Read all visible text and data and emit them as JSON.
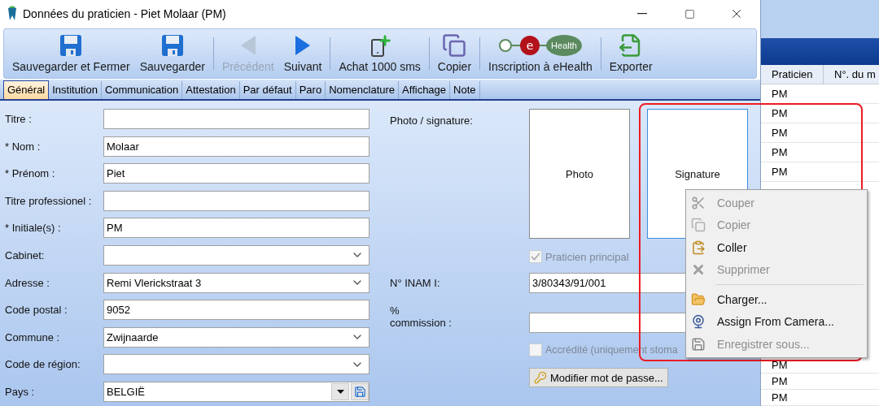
{
  "window": {
    "title": "Données du praticien - Piet Molaar (PM)"
  },
  "toolbar_groups": [
    [
      {
        "kind": "save-close",
        "label": "Sauvegarder et Fermer",
        "disabled": false
      },
      {
        "kind": "save",
        "label": "Sauvegarder",
        "disabled": false
      }
    ],
    [
      {
        "kind": "previous",
        "label": "Précédent",
        "disabled": true
      },
      {
        "kind": "next",
        "label": "Suivant",
        "disabled": false
      }
    ],
    [
      {
        "kind": "sms",
        "label": "Achat 1000 sms",
        "disabled": false
      }
    ],
    [
      {
        "kind": "copy",
        "label": "Copier",
        "disabled": false
      }
    ],
    [
      {
        "kind": "ehealth",
        "label": "Inscription à eHealth",
        "logo_texts": [
          "e",
          "Health"
        ],
        "disabled": false
      }
    ],
    [
      {
        "kind": "export",
        "label": "Exporter",
        "disabled": false
      }
    ]
  ],
  "tabs": [
    {
      "label": "Général",
      "selected": true
    },
    {
      "label": "Institution",
      "selected": false
    },
    {
      "label": "Communication",
      "selected": false
    },
    {
      "label": "Attestation",
      "selected": false
    },
    {
      "label": "Par défaut",
      "selected": false
    },
    {
      "label": "Paro",
      "selected": false
    },
    {
      "label": "Nomenclature",
      "selected": false
    },
    {
      "label": "Affichage",
      "selected": false
    },
    {
      "label": "Note",
      "selected": false
    }
  ],
  "fields": [
    {
      "label": "Titre :",
      "kind": "text"
    },
    {
      "label": "* Nom :",
      "kind": "text",
      "value": "Molaar"
    },
    {
      "label": "* Prénom :",
      "kind": "text",
      "value": "Piet"
    },
    {
      "label": "Titre professionel :",
      "kind": "text"
    },
    {
      "label": "* Initiale(s) :",
      "kind": "text",
      "value": "PM"
    },
    {
      "label": "Cabinet:",
      "kind": "select"
    },
    {
      "label": "Adresse :",
      "kind": "select",
      "value": "Remi Vlerickstraat 3"
    },
    {
      "label": "Code postal :",
      "kind": "text",
      "value": "9052"
    },
    {
      "label": "Commune :",
      "kind": "select",
      "value": "Zwijnaarde"
    },
    {
      "label": "Code de région:",
      "kind": "select"
    },
    {
      "label": "Pays :",
      "kind": "select-save",
      "value": "BELGIË"
    }
  ],
  "photo_section": {
    "label": "Photo / signature:",
    "photo": "Photo",
    "signature": {
      "label": "Signature",
      "selected": true
    }
  },
  "main_practitioner": {
    "label": "Praticien principal",
    "checked": true,
    "disabled": true
  },
  "inami": {
    "label": "N° INAM I:",
    "value": "3/80343/91/001"
  },
  "commission": {
    "label_lines": [
      "%",
      "commission :"
    ]
  },
  "accredited": {
    "label": "Accrédité (uniquement stoma",
    "checked": false,
    "disabled": true
  },
  "password_button": "Modifier mot de passe...",
  "context_menu": [
    {
      "kind": "cut",
      "label": "Couper",
      "disabled": true
    },
    {
      "kind": "copy",
      "label": "Copier",
      "disabled": true
    },
    {
      "kind": "paste",
      "label": "Coller",
      "disabled": false
    },
    {
      "kind": "delete",
      "label": "Supprimer",
      "disabled": true
    },
    {
      "kind": "separator"
    },
    {
      "kind": "load",
      "label": "Charger...",
      "disabled": false
    },
    {
      "kind": "camera",
      "label": "Assign From Camera...",
      "disabled": false
    },
    {
      "kind": "save",
      "label": "Enregistrer sous...",
      "disabled": true
    }
  ],
  "background_table": {
    "columns": [
      "Praticien",
      "N°. du m"
    ],
    "rows_above_menu": [
      "PM",
      "PM",
      "PM",
      "PM",
      "PM"
    ],
    "rows_below_menu": [
      "PM",
      "PM",
      "PM"
    ]
  }
}
